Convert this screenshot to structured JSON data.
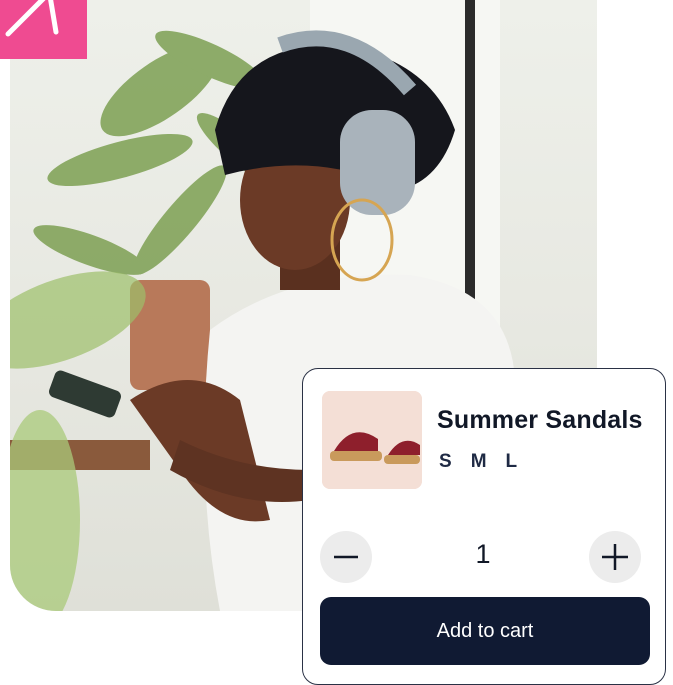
{
  "product": {
    "title": "Summer Sandals",
    "sizes": [
      "S",
      "M",
      "L"
    ],
    "quantity": "1",
    "add_to_cart_label": "Add to cart",
    "image_icon": "sandals-photo"
  },
  "colors": {
    "badge": "#ef4b91",
    "button": "#101a33",
    "card_border": "#2a3145"
  }
}
